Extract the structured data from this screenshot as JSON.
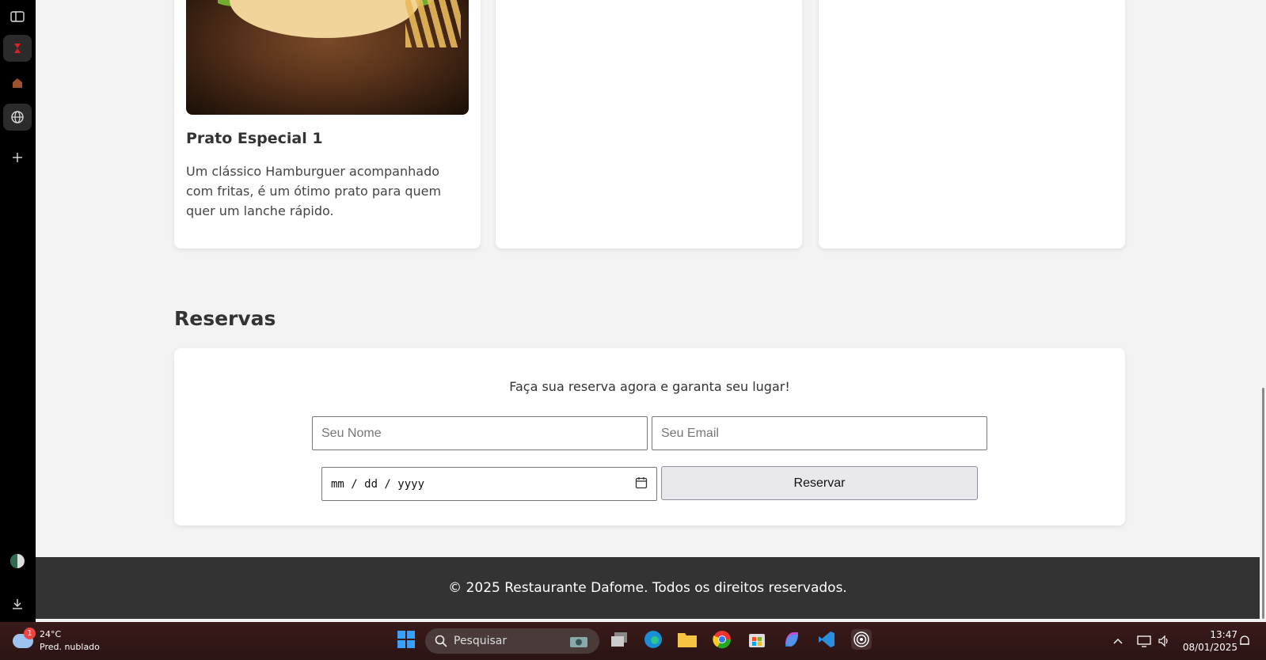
{
  "browser": {
    "sidebar_icons": [
      "sidebar-toggle-icon",
      "app-icon-red",
      "app-icon-house",
      "globe-icon",
      "plus-icon",
      "profile-icon",
      "download-icon"
    ]
  },
  "page": {
    "card": {
      "title": "Prato Especial 1",
      "description": "Um clássico Hamburguer acompanhado com fritas, é um ótimo prato para quem quer um lanche rápido."
    },
    "reservas": {
      "title": "Reservas",
      "subtitle": "Faça sua reserva agora e garanta seu lugar!",
      "name_placeholder": "Seu Nome",
      "email_placeholder": "Seu Email",
      "date_placeholder": "mm / dd / yyyy",
      "submit_label": "Reservar"
    },
    "footer": "© 2025 Restaurante Dafome. Todos os direitos reservados."
  },
  "taskbar": {
    "weather": {
      "temp": "24°C",
      "desc": "Pred. nublado",
      "badge": "1"
    },
    "search_placeholder": "Pesquisar",
    "time": "13:47",
    "date": "08/01/2025"
  },
  "colors": {
    "footer_bg": "#333333",
    "page_bg": "#f3f3f3",
    "taskbar_bg": "#2b1414"
  }
}
